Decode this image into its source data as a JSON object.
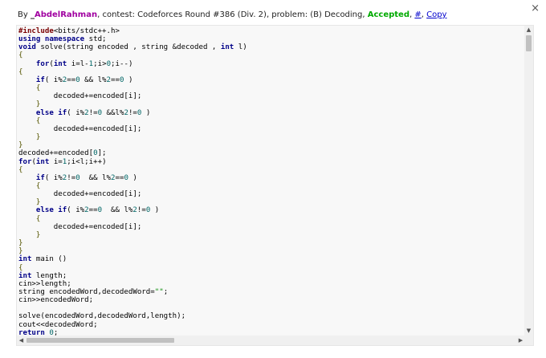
{
  "header": {
    "by_label": "By",
    "user_prefix": "_",
    "user_rest": "AbdelRahman",
    "contest_label": ", contest: ",
    "contest_name": "Codeforces Round #386 (Div. 2)",
    "problem_label": ", problem: ",
    "problem_name": "(B) Decoding",
    "sep": ", ",
    "verdict": "Accepted",
    "sep2": ", ",
    "hash_link": "#",
    "sep3": ", ",
    "copy_link": "Copy"
  },
  "close_glyph": "×",
  "scroll": {
    "up_glyph": "▲",
    "down_glyph": "▼",
    "left_glyph": "◀",
    "right_glyph": "▶"
  },
  "code_lines": [
    [
      [
        "pp",
        "#include"
      ],
      [
        "p",
        "<bits/stdc++.h>"
      ]
    ],
    [
      [
        "kw",
        "using"
      ],
      [
        "p",
        " "
      ],
      [
        "kw",
        "namespace"
      ],
      [
        "p",
        " std;"
      ]
    ],
    [
      [
        "kw",
        "void"
      ],
      [
        "p",
        " solve(string encoded , string &decoded , "
      ],
      [
        "kw",
        "int"
      ],
      [
        "p",
        " l)"
      ]
    ],
    [
      [
        "pun",
        "{"
      ]
    ],
    [
      [
        "p",
        "    "
      ],
      [
        "kw",
        "for"
      ],
      [
        "p",
        "("
      ],
      [
        "kw",
        "int"
      ],
      [
        "p",
        " i=l-"
      ],
      [
        "num",
        "1"
      ],
      [
        "p",
        ";i>"
      ],
      [
        "num",
        "0"
      ],
      [
        "p",
        ";i--)"
      ]
    ],
    [
      [
        "pun",
        "{"
      ]
    ],
    [
      [
        "p",
        "    "
      ],
      [
        "kw",
        "if"
      ],
      [
        "p",
        "( i%"
      ],
      [
        "num",
        "2"
      ],
      [
        "p",
        "=="
      ],
      [
        "num",
        "0"
      ],
      [
        "p",
        " && l%"
      ],
      [
        "num",
        "2"
      ],
      [
        "p",
        "=="
      ],
      [
        "num",
        "0"
      ],
      [
        "p",
        " )"
      ]
    ],
    [
      [
        "p",
        "    "
      ],
      [
        "pun",
        "{"
      ]
    ],
    [
      [
        "p",
        "        decoded+=encoded[i];"
      ]
    ],
    [
      [
        "p",
        "    "
      ],
      [
        "pun",
        "}"
      ]
    ],
    [
      [
        "p",
        "    "
      ],
      [
        "kw",
        "else"
      ],
      [
        "p",
        " "
      ],
      [
        "kw",
        "if"
      ],
      [
        "p",
        "( i%"
      ],
      [
        "num",
        "2"
      ],
      [
        "p",
        "!="
      ],
      [
        "num",
        "0"
      ],
      [
        "p",
        " &&l%"
      ],
      [
        "num",
        "2"
      ],
      [
        "p",
        "!="
      ],
      [
        "num",
        "0"
      ],
      [
        "p",
        " )"
      ]
    ],
    [
      [
        "p",
        "    "
      ],
      [
        "pun",
        "{"
      ]
    ],
    [
      [
        "p",
        "        decoded+=encoded[i];"
      ]
    ],
    [
      [
        "p",
        "    "
      ],
      [
        "pun",
        "}"
      ]
    ],
    [
      [
        "pun",
        "}"
      ]
    ],
    [
      [
        "p",
        "decoded+=encoded["
      ],
      [
        "num",
        "0"
      ],
      [
        "p",
        "];"
      ]
    ],
    [
      [
        "kw",
        "for"
      ],
      [
        "p",
        "("
      ],
      [
        "kw",
        "int"
      ],
      [
        "p",
        " i="
      ],
      [
        "num",
        "1"
      ],
      [
        "p",
        ";i<l;i++)"
      ]
    ],
    [
      [
        "pun",
        "{"
      ]
    ],
    [
      [
        "p",
        "    "
      ],
      [
        "kw",
        "if"
      ],
      [
        "p",
        "( i%"
      ],
      [
        "num",
        "2"
      ],
      [
        "p",
        "!="
      ],
      [
        "num",
        "0"
      ],
      [
        "p",
        "  && l%"
      ],
      [
        "num",
        "2"
      ],
      [
        "p",
        "=="
      ],
      [
        "num",
        "0"
      ],
      [
        "p",
        " )"
      ]
    ],
    [
      [
        "p",
        "    "
      ],
      [
        "pun",
        "{"
      ]
    ],
    [
      [
        "p",
        "        decoded+=encoded[i];"
      ]
    ],
    [
      [
        "p",
        "    "
      ],
      [
        "pun",
        "}"
      ]
    ],
    [
      [
        "p",
        "    "
      ],
      [
        "kw",
        "else"
      ],
      [
        "p",
        " "
      ],
      [
        "kw",
        "if"
      ],
      [
        "p",
        "( i%"
      ],
      [
        "num",
        "2"
      ],
      [
        "p",
        "=="
      ],
      [
        "num",
        "0"
      ],
      [
        "p",
        "  && l%"
      ],
      [
        "num",
        "2"
      ],
      [
        "p",
        "!="
      ],
      [
        "num",
        "0"
      ],
      [
        "p",
        " )"
      ]
    ],
    [
      [
        "p",
        "    "
      ],
      [
        "pun",
        "{"
      ]
    ],
    [
      [
        "p",
        "        decoded+=encoded[i];"
      ]
    ],
    [
      [
        "p",
        "    "
      ],
      [
        "pun",
        "}"
      ]
    ],
    [
      [
        "pun",
        "}"
      ]
    ],
    [
      [
        "pun",
        "}"
      ]
    ],
    [
      [
        "kw",
        "int"
      ],
      [
        "p",
        " main ()"
      ]
    ],
    [
      [
        "pun",
        "{"
      ]
    ],
    [
      [
        "kw",
        "int"
      ],
      [
        "p",
        " length;"
      ]
    ],
    [
      [
        "p",
        "cin>>length;"
      ]
    ],
    [
      [
        "p",
        "string encodedWord,decodedWord="
      ],
      [
        "str",
        "\"\""
      ],
      [
        "p",
        ";"
      ]
    ],
    [
      [
        "p",
        "cin>>encodedWord;"
      ]
    ],
    [
      [
        "p",
        ""
      ]
    ],
    [
      [
        "p",
        "solve(encodedWord,decodedWord,length);"
      ]
    ],
    [
      [
        "p",
        "cout<<decodedWord;"
      ]
    ],
    [
      [
        "kw",
        "return"
      ],
      [
        "p",
        " "
      ],
      [
        "num",
        "0"
      ],
      [
        "p",
        ";"
      ]
    ]
  ]
}
